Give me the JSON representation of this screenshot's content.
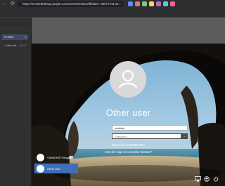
{
  "browser": {
    "url": "https://remotedesktop.google.com/access/session/5ffdadd-.-060f-4744-a2...",
    "nav_back": "←",
    "nav_reload": "⟳",
    "extensions": [
      "#5b8def",
      "#e57373",
      "#81c784",
      "#ffd54f",
      "#ba68c8",
      "#4dd0e1",
      "#f06292"
    ]
  },
  "sidebar": {
    "selected_label": "PLDBIS",
    "new_tab_label": "New tab",
    "new_tab_hint": "Ctrl+T"
  },
  "lockscreen": {
    "user_name": "Other user",
    "username_value": "cuidado",
    "password_placeholder": "Password",
    "submit_icon": "→",
    "sign_in_to": "Sign in to: VIAMONSTRA",
    "how_to": "How do I sign in to another domain?",
    "users": [
      {
        "label": "VIAMONSTRA\\gyh..."
      },
      {
        "label": "Other user"
      }
    ],
    "bottom_icons": [
      "network-icon",
      "accessibility-icon",
      "power-icon"
    ]
  }
}
